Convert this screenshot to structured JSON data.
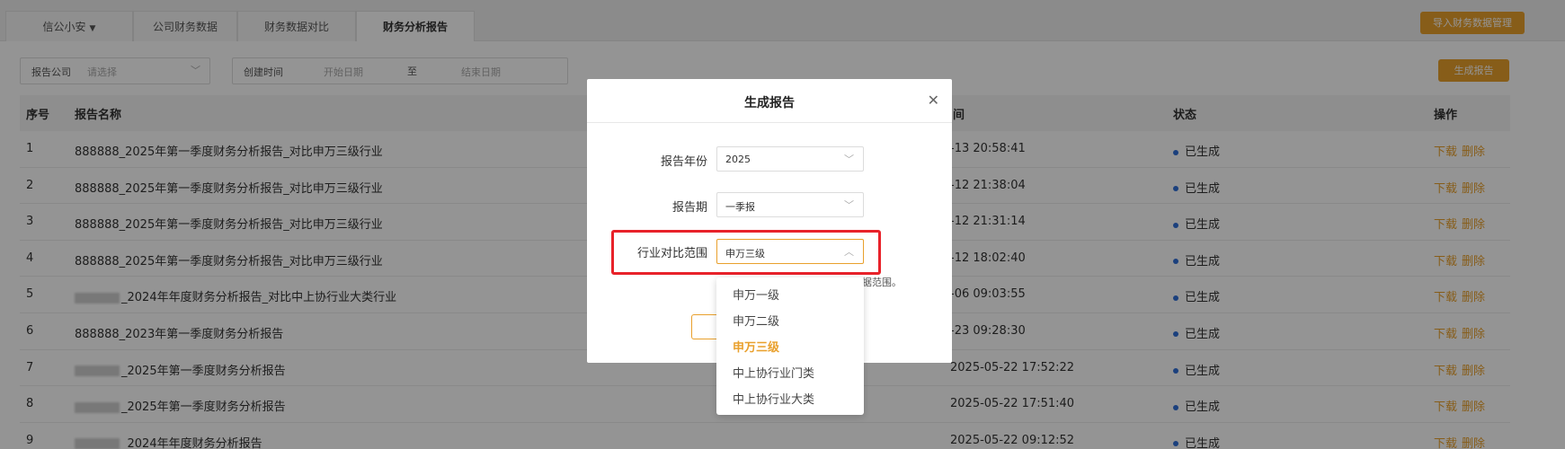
{
  "tabs": [
    {
      "label": "信公小安",
      "has_caret": true
    },
    {
      "label": "公司财务数据"
    },
    {
      "label": "财务数据对比"
    },
    {
      "label": "财务分析报告"
    }
  ],
  "actions": {
    "import_label": "导入财务数据管理",
    "generate_label": "生成报告"
  },
  "filters": {
    "company_label": "报告公司",
    "company_placeholder": "请选择",
    "time_label": "创建时间",
    "start_placeholder": "开始日期",
    "to": "至",
    "end_placeholder": "结束日期"
  },
  "table": {
    "headers": [
      "序号",
      "报告名称",
      "间",
      "状态",
      "操作"
    ],
    "rows": [
      {
        "no": "1",
        "name": "888888_2025年第一季度财务分析报告_对比申万三级行业",
        "time": "-13 20:58:41",
        "status": "已生成",
        "blurred": false
      },
      {
        "no": "2",
        "name": "888888_2025年第一季度财务分析报告_对比申万三级行业",
        "time": "-12 21:38:04",
        "status": "已生成",
        "blurred": false
      },
      {
        "no": "3",
        "name": "888888_2025年第一季度财务分析报告_对比申万三级行业",
        "time": "-12 21:31:14",
        "status": "已生成",
        "blurred": false
      },
      {
        "no": "4",
        "name": "888888_2025年第一季度财务分析报告_对比申万三级行业",
        "time": "-12 18:02:40",
        "status": "已生成",
        "blurred": false
      },
      {
        "no": "5",
        "name": "_2024年年度财务分析报告_对比中上协行业大类行业",
        "time": "-06 09:03:55",
        "status": "已生成",
        "blurred": true
      },
      {
        "no": "6",
        "name": "888888_2023年第一季度财务分析报告",
        "time": "-23 09:28:30",
        "status": "已生成",
        "blurred": false
      },
      {
        "no": "7",
        "name": "_2025年第一季度财务分析报告",
        "time": "2025-05-22 17:52:22",
        "status": "已生成",
        "blurred": true
      },
      {
        "no": "8",
        "name": "_2025年第一季度财务分析报告",
        "time": "2025-05-22 17:51:40",
        "status": "已生成",
        "blurred": true
      },
      {
        "no": "9",
        "name": "_2024年年度财务分析报告",
        "time": "2025-05-22 09:12:52",
        "status": "已生成",
        "blurred": true
      }
    ],
    "download_label": "下载",
    "delete_label": "删除"
  },
  "modal": {
    "title": "生成报告",
    "year_label": "报告年份",
    "year_value": "2025",
    "period_label": "报告期",
    "period_value": "一季报",
    "industry_label": "行业对比范围",
    "industry_value": "申万三级",
    "hint_fragment": "据范围。"
  },
  "dropdown": {
    "options": [
      "申万一级",
      "申万二级",
      "申万三级",
      "中上协行业门类",
      "中上协行业大类"
    ],
    "selected": "申万三级"
  },
  "icons": {
    "chevron_down": "chevron-down-icon",
    "chevron_up": "chevron-up-icon",
    "close": "close-icon",
    "status_dot": "status-dot-icon"
  },
  "colors": {
    "accent": "#e9a02c",
    "status_blue": "#2f6fd8",
    "highlight_red": "#e8222a"
  }
}
